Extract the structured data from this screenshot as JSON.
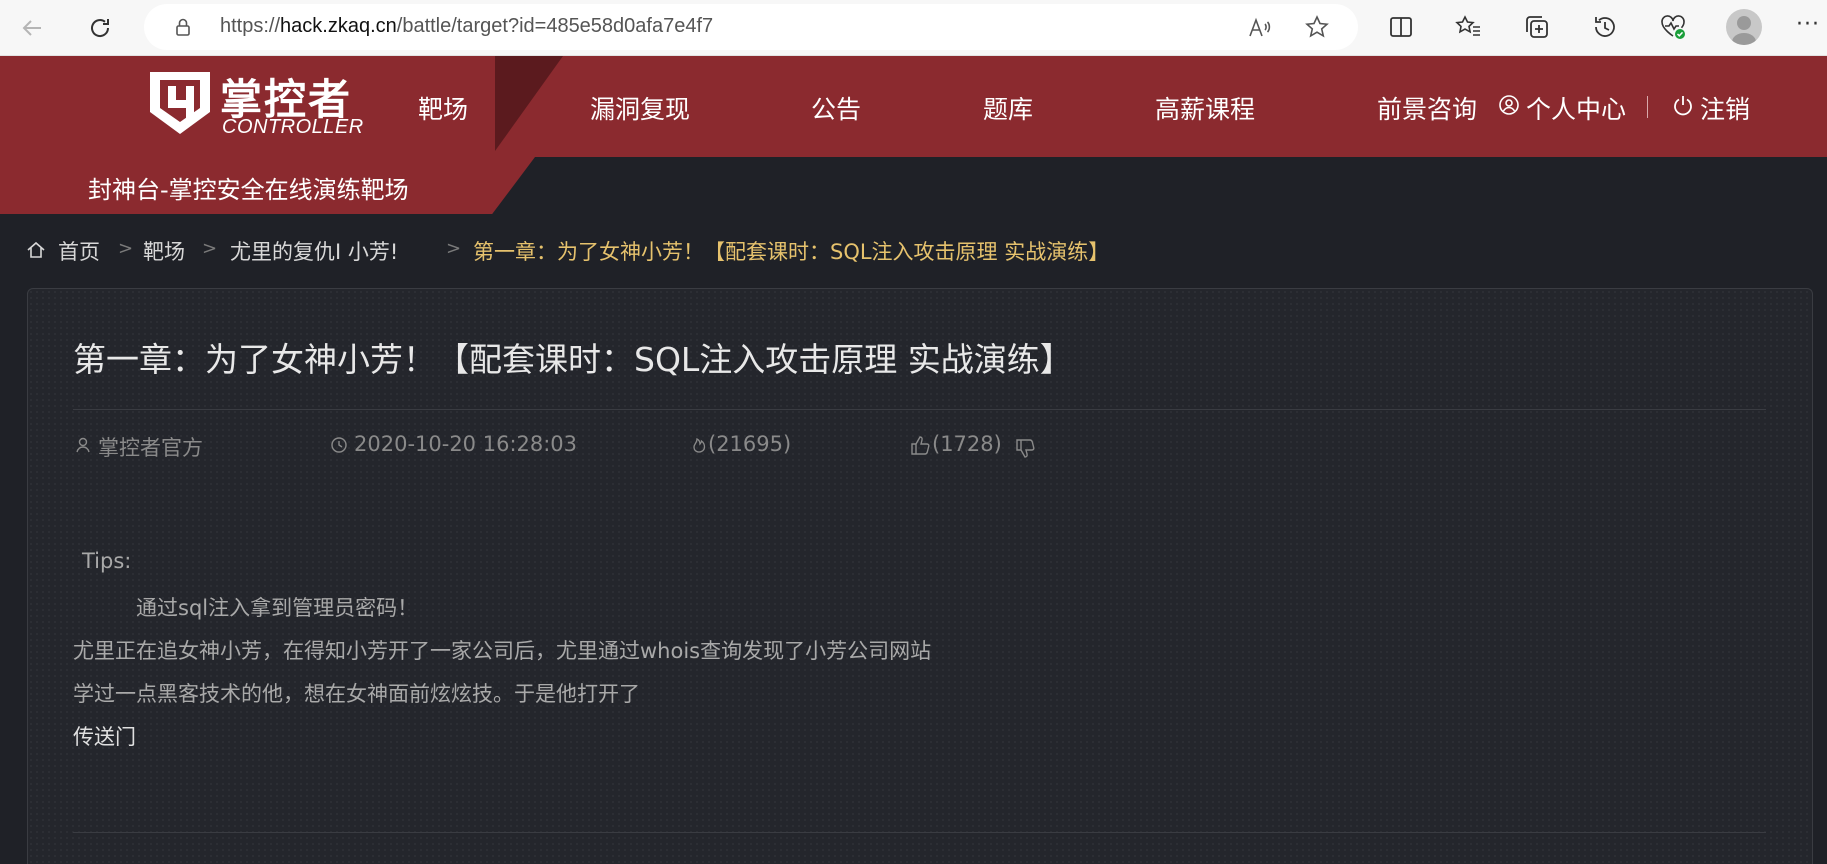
{
  "browser": {
    "url_prefix": "https://",
    "url_host": "hack.zkaq.cn",
    "url_path": "/battle/target?id=485e58d0afa7e4f7"
  },
  "site": {
    "logo_cn": "掌控者",
    "logo_en": "CONTROLLER",
    "tagline": "封神台-掌控安全在线演练靶场",
    "nav": [
      "靶场",
      "漏洞复现",
      "公告",
      "题库",
      "高薪课程",
      "前景咨询"
    ],
    "user_center": "个人中心",
    "logout": "注销"
  },
  "breadcrumb": {
    "home": "首页",
    "items": [
      "靶场",
      "尤里的复仇Ⅰ 小芳!"
    ],
    "current": "第一章：为了女神小芳！【配套课时：SQL注入攻击原理 实战演练】"
  },
  "article": {
    "title": "第一章：为了女神小芳！【配套课时：SQL注入攻击原理 实战演练】",
    "author": "掌控者官方",
    "datetime": "2020-10-20 16:28:03",
    "views": "(21695)",
    "likes": "(1728)",
    "tips_label": "Tips:",
    "lines": [
      "通过sql注入拿到管理员密码！",
      "尤里正在追女神小芳，在得知小芳开了一家公司后，尤里通过whois查询发现了小芳公司网站",
      "学过一点黑客技术的他，想在女神面前炫炫技。于是他打开了"
    ],
    "link": "传送门"
  },
  "colors": {
    "brand_red": "#8b2a2f",
    "breadcrumb_current": "#e6c26d",
    "background": "#1f2127"
  }
}
